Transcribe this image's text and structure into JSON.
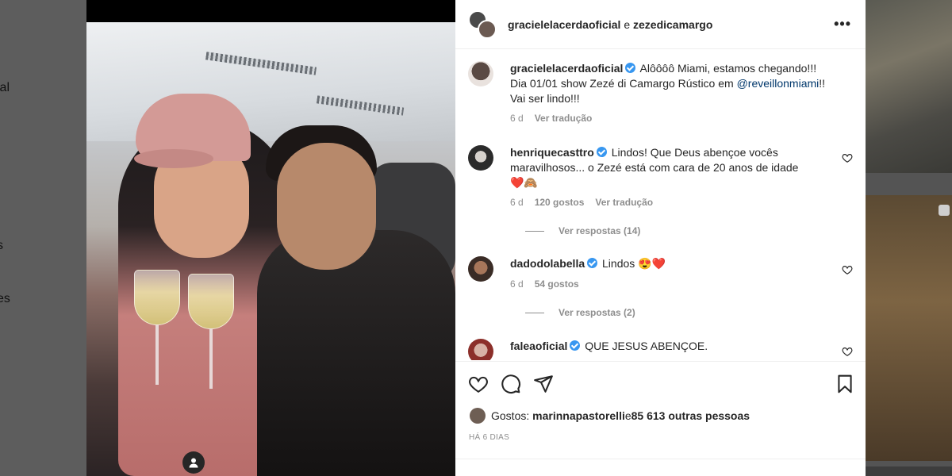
{
  "background_left": {
    "fragments": [
      "ial",
      "s",
      "es"
    ]
  },
  "post": {
    "header": {
      "user1": "gracielelacerdaoficial",
      "separator": "e",
      "user2": "zezedicamargo",
      "more_icon": "more-horizontal-icon",
      "more_label": "•••"
    },
    "caption": {
      "username": "gracielelacerdaoficial",
      "text_part1": " Alôôôô Miami, estamos chegando!!! Dia 01/01 show Zezé di Camargo Rústico em ",
      "mention": "@reveillonmiami",
      "text_part2": "!! Vai ser lindo!!!",
      "age": "6 d",
      "translate": "Ver tradução"
    },
    "comments": [
      {
        "username": "henriquecasttro",
        "text": " Lindos! Que Deus abençoe vocês maravilhosos... o Zezé está com cara de 20 anos de idade",
        "emojis": "❤️🙈",
        "age": "6 d",
        "likes": "120 gostos",
        "translate": "Ver tradução",
        "replies": "Ver respostas (14)"
      },
      {
        "username": "dadodolabella",
        "text": " Lindos 😍❤️",
        "age": "6 d",
        "likes": "54 gostos",
        "replies": "Ver respostas (2)"
      },
      {
        "username": "faleaoficial",
        "text": " QUE JESUS ABENÇOE."
      }
    ],
    "actions": {
      "like_icon": "heart-icon",
      "comment_icon": "comment-icon",
      "share_icon": "send-icon",
      "save_icon": "bookmark-icon"
    },
    "likes": {
      "prefix": "Gostos: ",
      "user": "marinnapastorelli",
      "middle": " e ",
      "others": "85 613 outras pessoas"
    },
    "timestamp": "HÁ 6 DIAS"
  },
  "colors": {
    "verified": "#3897f0",
    "link": "#00376b",
    "secondary_text": "#8e8e8e",
    "like_heart": "#ed4956"
  }
}
